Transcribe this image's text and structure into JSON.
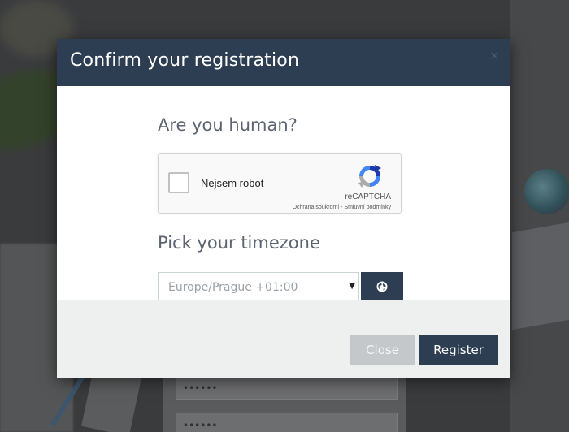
{
  "background": {
    "password_field_1": "••••••",
    "password_field_2": "••••••"
  },
  "modal": {
    "title": "Confirm your registration",
    "close_icon": "×",
    "captcha_section": {
      "heading": "Are you human?",
      "checkbox_label": "Nejsem robot",
      "brand": "reCAPTCHA",
      "privacy_link": "Ochrana soukromí",
      "separator": " - ",
      "terms_link": "Smluvní podmínky"
    },
    "timezone_section": {
      "heading": "Pick your timezone",
      "selected_value": "Europe/Prague +01:00",
      "caret": "▼",
      "detect_button_icon": "globe-icon"
    },
    "footer": {
      "close_label": "Close",
      "register_label": "Register"
    }
  },
  "colors": {
    "header_bg": "#2e3e52",
    "primary_button": "#2e3e52",
    "disabled_button": "#c5c8cb",
    "footer_bg": "#eef0f0",
    "heading_text": "#5b6470"
  }
}
